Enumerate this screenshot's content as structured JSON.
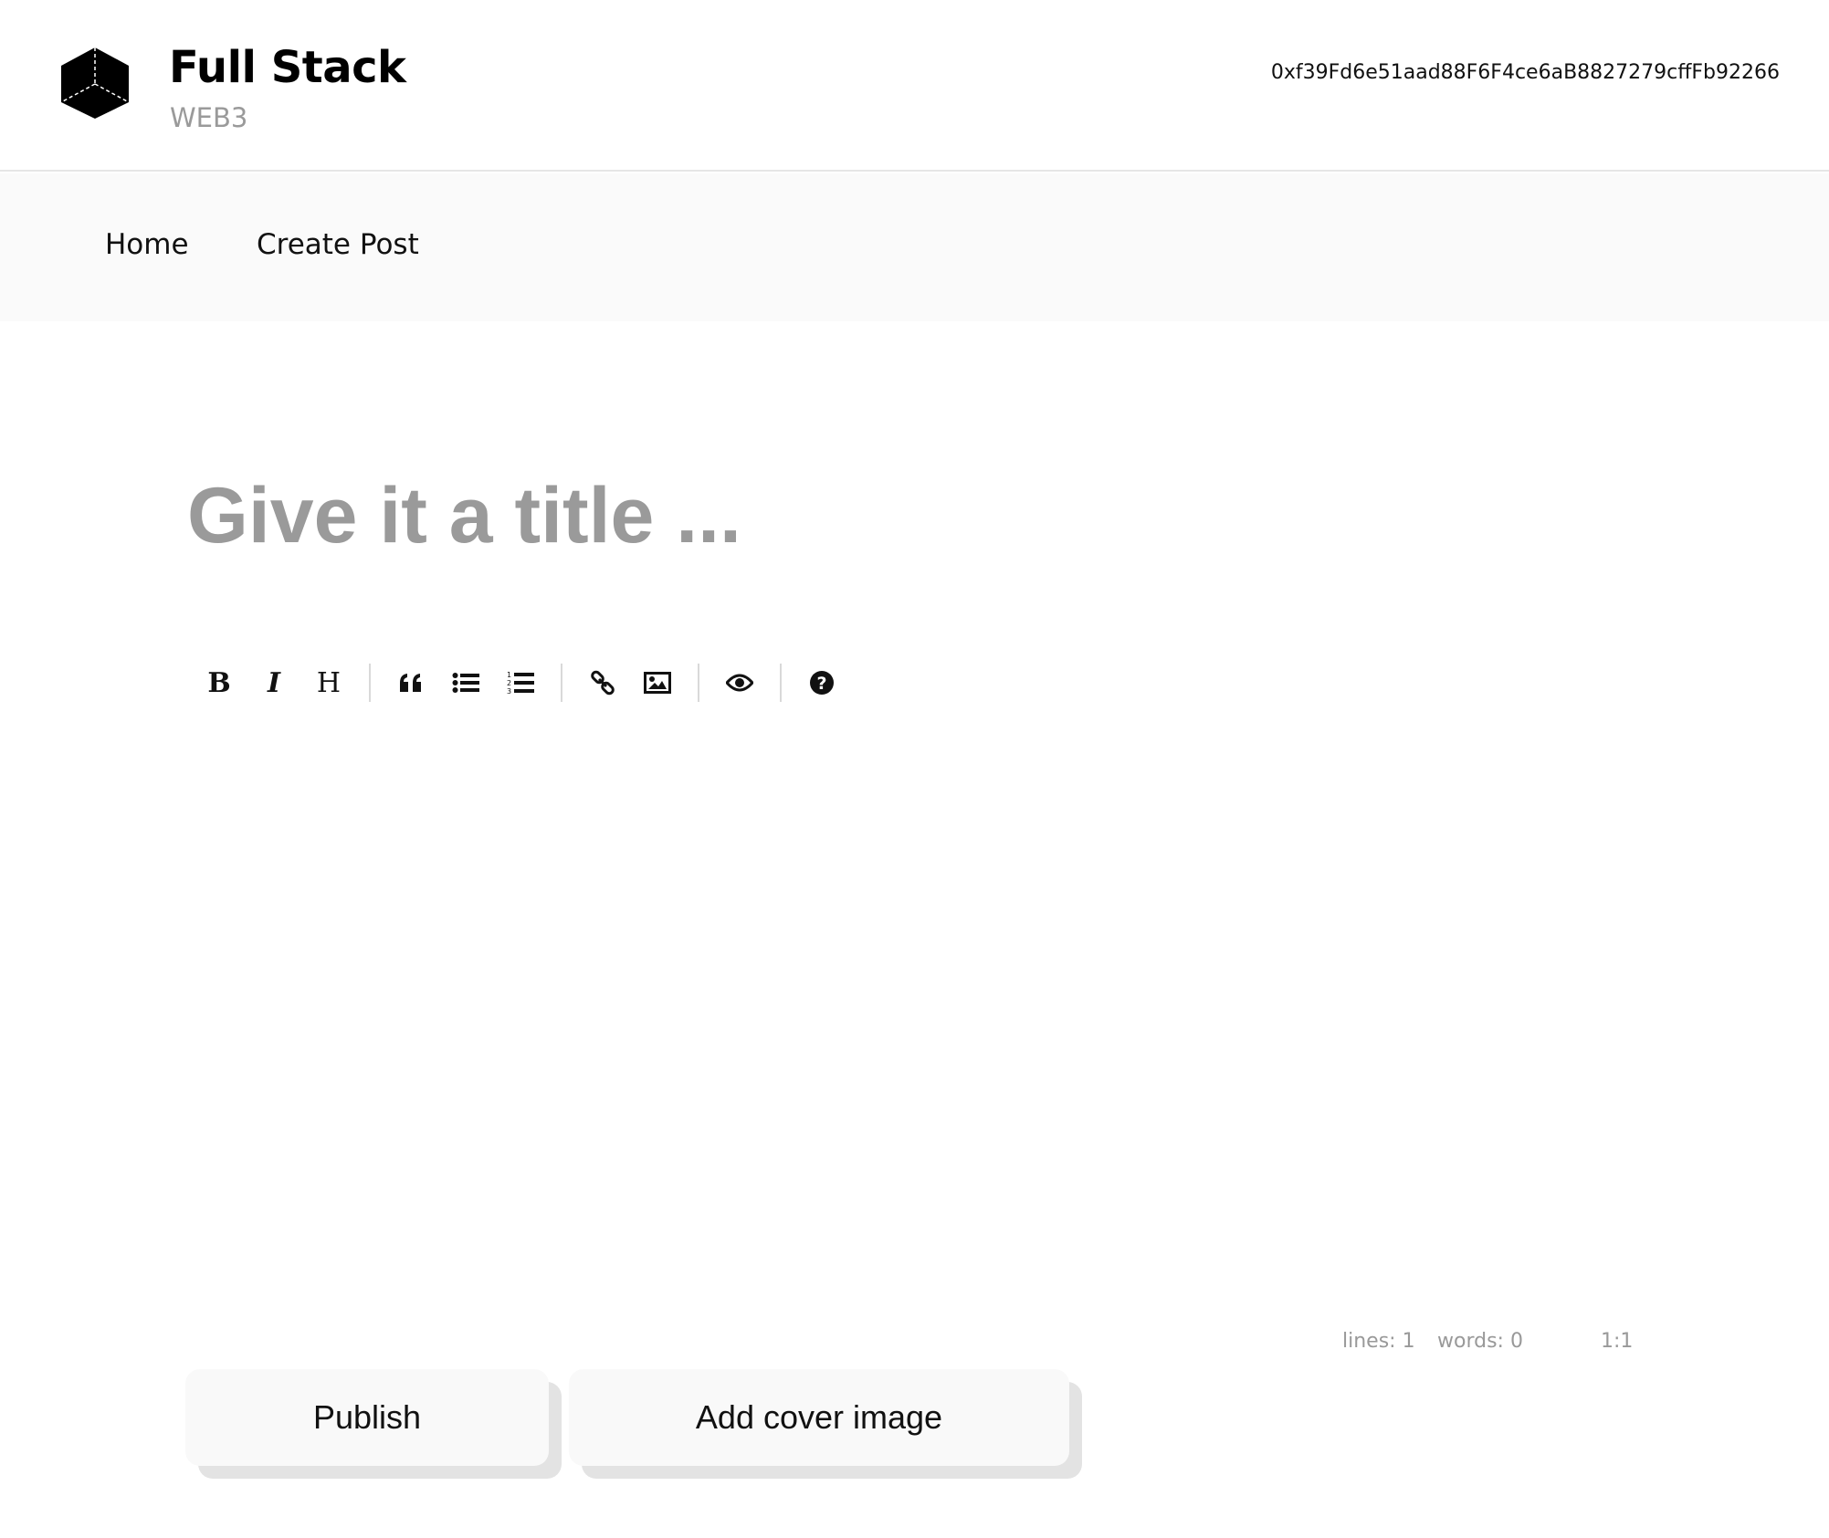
{
  "brand": {
    "title": "Full Stack",
    "subtitle": "WEB3",
    "logo_icon": "cube-icon"
  },
  "wallet": {
    "address": "0xf39Fd6e51aad88F6F4ce6aB8827279cffFb92266"
  },
  "nav": {
    "items": [
      {
        "label": "Home"
      },
      {
        "label": "Create Post"
      }
    ]
  },
  "editor": {
    "title_placeholder": "Give it a title ...",
    "body_value": "",
    "toolbar": [
      {
        "name": "bold-button",
        "glyph": "B",
        "icon": "bold-icon"
      },
      {
        "name": "italic-button",
        "glyph": "I",
        "icon": "italic-icon"
      },
      {
        "name": "heading-button",
        "glyph": "H",
        "icon": "heading-icon"
      },
      {
        "name": "quote-button",
        "icon": "quote-icon"
      },
      {
        "name": "unordered-list-button",
        "icon": "unordered-list-icon"
      },
      {
        "name": "ordered-list-button",
        "icon": "ordered-list-icon"
      },
      {
        "name": "link-button",
        "icon": "link-icon"
      },
      {
        "name": "image-button",
        "icon": "image-icon"
      },
      {
        "name": "preview-button",
        "icon": "eye-icon"
      },
      {
        "name": "guide-button",
        "icon": "question-circle-icon"
      }
    ],
    "status": {
      "lines": "lines: 1",
      "words": "words: 0",
      "cursor": "1:1"
    }
  },
  "actions": {
    "publish_label": "Publish",
    "cover_label": "Add cover image"
  },
  "colors": {
    "background": "#ffffff",
    "nav_background": "#fafafa",
    "placeholder": "#9a9a9a",
    "button_background": "#f9f9f9",
    "button_shadow": "#e3e3e3"
  }
}
